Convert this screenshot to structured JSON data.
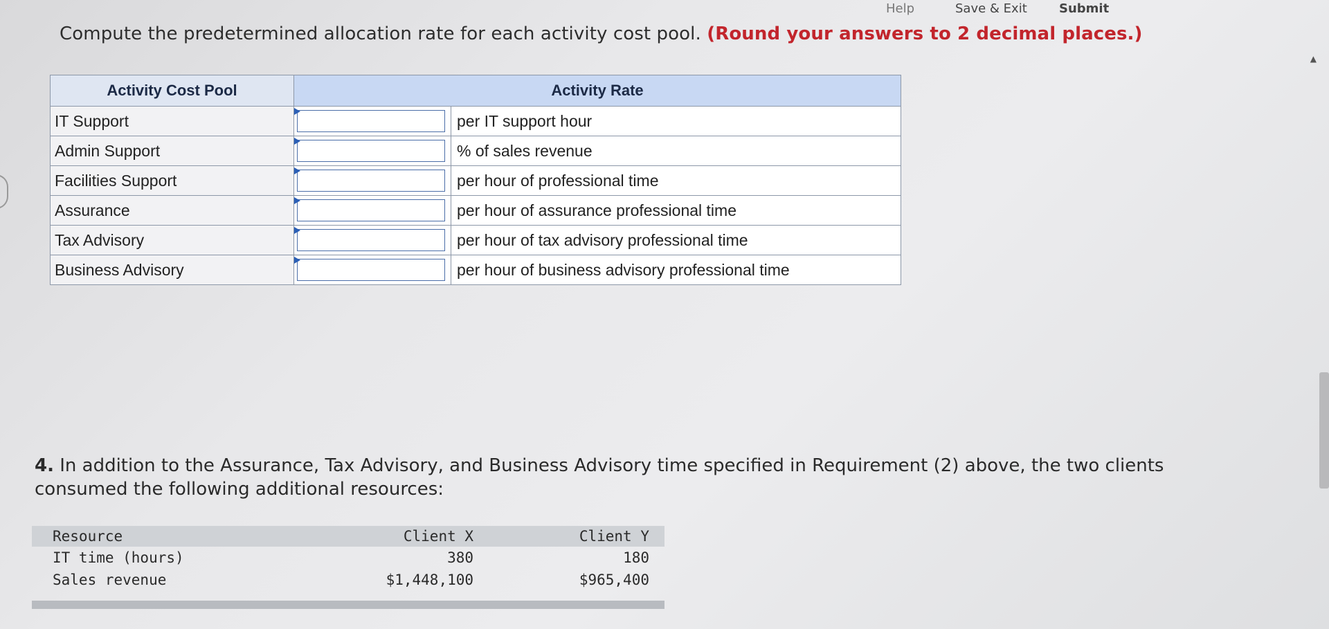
{
  "topbar": {
    "help": "Help",
    "save_exit": "Save & Exit",
    "submit": "Submit"
  },
  "instruction": {
    "text": "Compute the predetermined allocation rate for each activity cost pool.",
    "note": "(Round your answers to 2 decimal places.)"
  },
  "rate_table": {
    "header_pool": "Activity Cost Pool",
    "header_rate": "Activity Rate",
    "rows": [
      {
        "pool": "IT Support",
        "value": "",
        "unit": "per IT support hour"
      },
      {
        "pool": "Admin Support",
        "value": "",
        "unit": "% of sales revenue"
      },
      {
        "pool": "Facilities Support",
        "value": "",
        "unit": "per hour of professional time"
      },
      {
        "pool": "Assurance",
        "value": "",
        "unit": "per hour of assurance professional time"
      },
      {
        "pool": "Tax Advisory",
        "value": "",
        "unit": "per hour of tax advisory professional time"
      },
      {
        "pool": "Business Advisory",
        "value": "",
        "unit": "per hour of business advisory professional time"
      }
    ]
  },
  "question4": {
    "number": "4.",
    "text": "In addition to the Assurance, Tax Advisory, and Business Advisory time specified in Requirement (2) above, the two clients consumed the following additional resources:"
  },
  "resource_table": {
    "headers": [
      "Resource",
      "Client X",
      "Client Y"
    ],
    "rows": [
      [
        "IT time (hours)",
        "380",
        "180"
      ],
      [
        "Sales revenue",
        "$1,448,100",
        "$965,400"
      ]
    ]
  },
  "icons": {
    "scroll_up": "triangle-up-icon",
    "input_marker": "triangle-right-icon"
  },
  "colors": {
    "note_red": "#c2252c",
    "rate_header_blue": "#c8d8f3",
    "input_border_blue": "#4a6da8"
  }
}
